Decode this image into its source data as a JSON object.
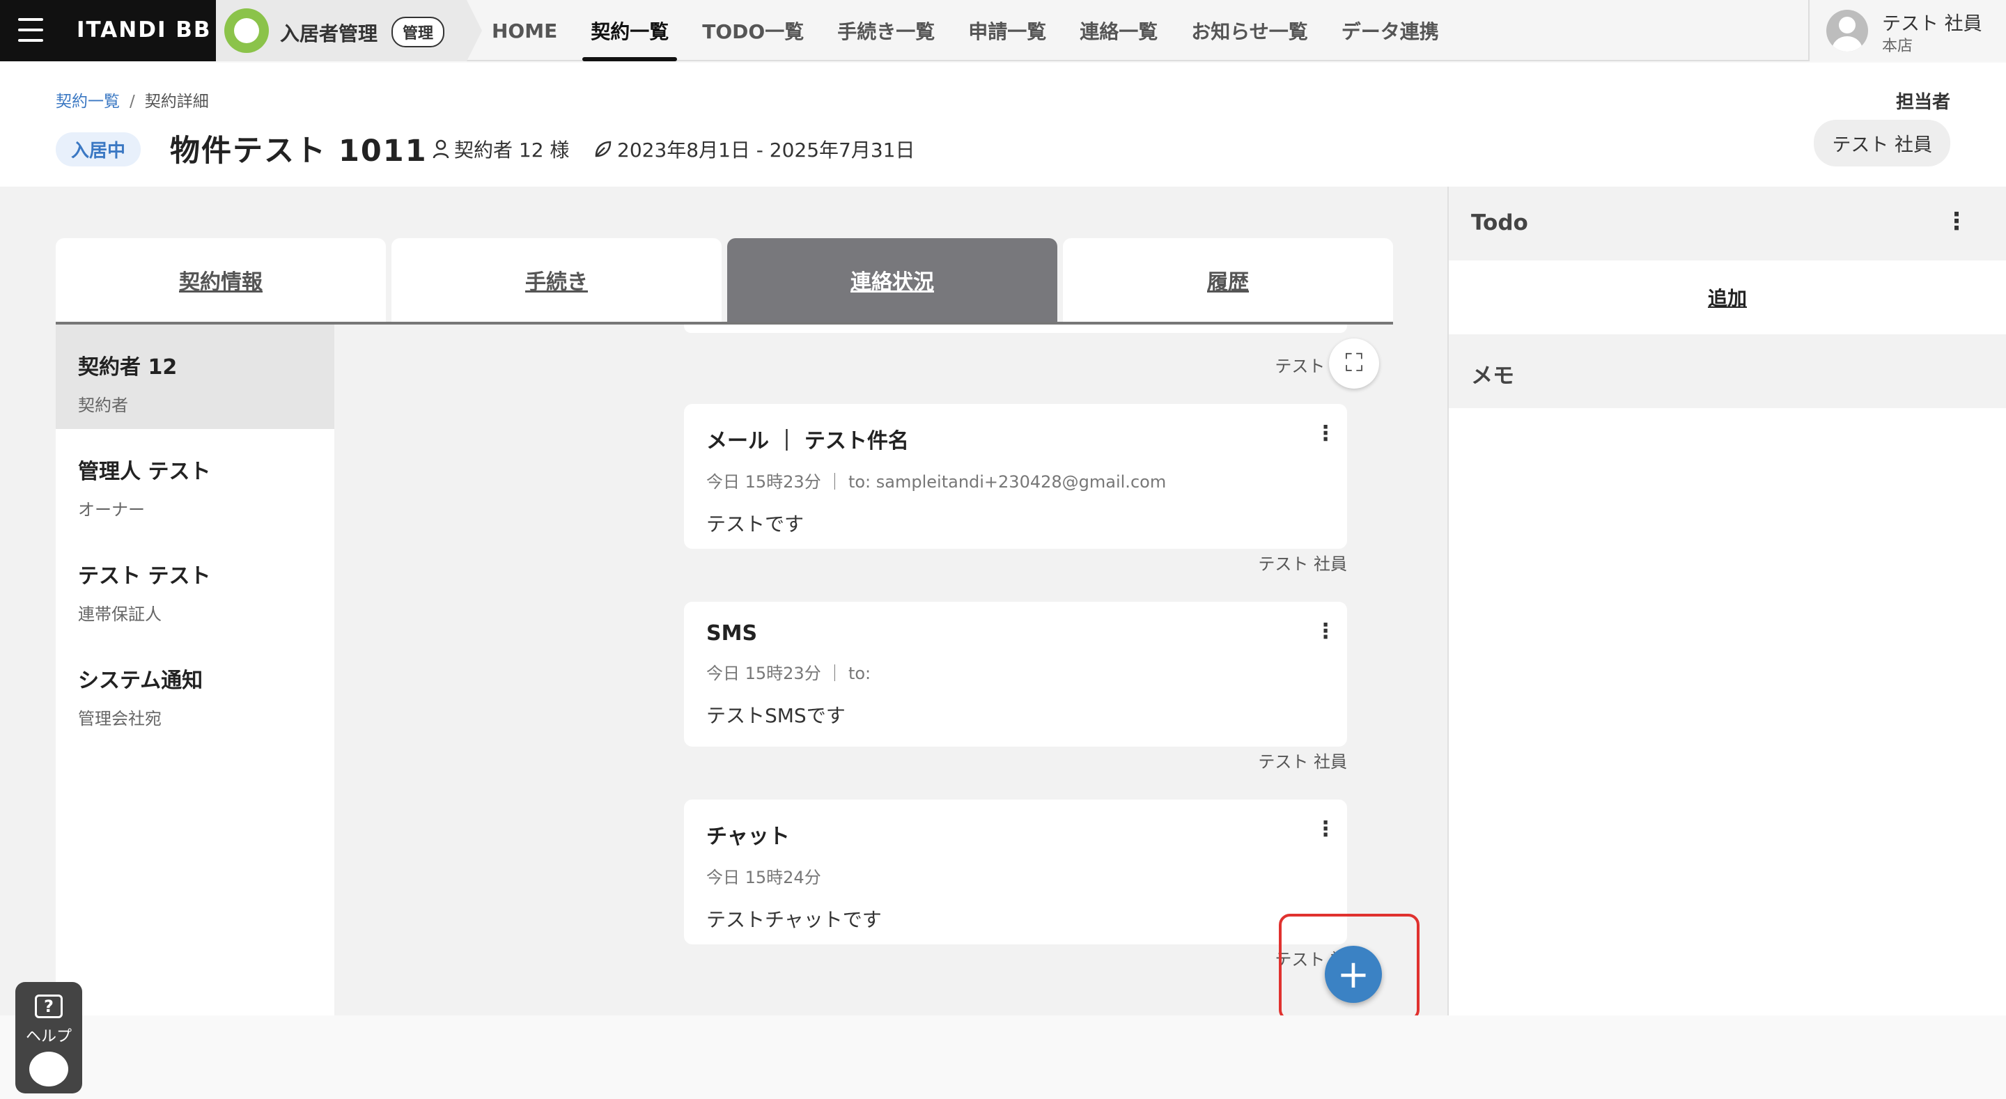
{
  "topbar": {
    "brand": "ITANDI BB",
    "app_name": "入居者管理",
    "app_badge": "管理",
    "nav": [
      "HOME",
      "契約一覧",
      "TODO一覧",
      "手続き一覧",
      "申請一覧",
      "連絡一覧",
      "お知らせ一覧",
      "データ連携"
    ],
    "active_nav": "契約一覧",
    "user_name": "テスト 社員",
    "user_branch": "本店"
  },
  "header": {
    "breadcrumb_root": "契約一覧",
    "breadcrumb_sep": "/",
    "breadcrumb_current": "契約詳細",
    "status": "入居中",
    "property_title": "物件テスト 1011",
    "contractor": "契約者 12 様",
    "period": "2023年8月1日 - 2025年7月31日",
    "assignee_label": "担当者",
    "assignee_name": "テスト 社員"
  },
  "tabs": [
    "契約情報",
    "手続き",
    "連絡状況",
    "履歴"
  ],
  "active_tab": "連絡状況",
  "contacts": [
    {
      "name": "契約者 12",
      "role": "契約者"
    },
    {
      "name": "管理人 テスト",
      "role": "オーナー"
    },
    {
      "name": "テスト テスト",
      "role": "連帯保証人"
    },
    {
      "name": "システム通知",
      "role": "管理会社宛"
    }
  ],
  "messages": [
    {
      "title": "メール ｜ テスト件名",
      "meta": "今日 15時23分 ｜ to: sampleitandi+230428@gmail.com",
      "body": "テストです",
      "sender": "テスト 社員"
    },
    {
      "title": "SMS",
      "meta": "今日 15時23分 ｜ to:",
      "body": "テストSMSです",
      "sender": "テスト 社員"
    },
    {
      "title": "チャット",
      "meta": "今日 15時24分",
      "body": "テストチャットです",
      "sender": "テスト 社"
    }
  ],
  "top_sender": "テスト 社",
  "side": {
    "todo_title": "Todo",
    "add_label": "追加",
    "memo_title": "メモ"
  },
  "help_label": "ヘルプ",
  "fab_symbol": "+",
  "icons": {
    "menu": "hamburger-icon",
    "user": "person-icon",
    "contract": "leaf-icon",
    "expand": "expand-icon",
    "more": "kebab-icon",
    "help": "help-icon"
  },
  "colors": {
    "accent_blue": "#3b82c4",
    "status_bg": "#e8f0fb",
    "active_tab": "#78787c",
    "highlight": "#e0322f"
  }
}
